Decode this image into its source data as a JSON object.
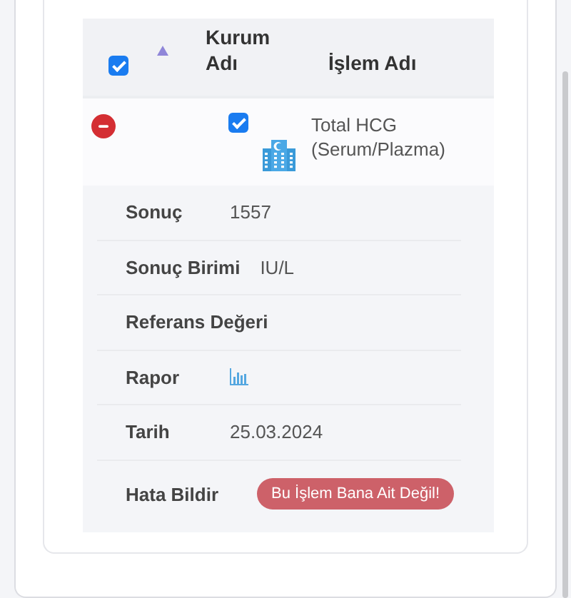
{
  "table": {
    "select_all": {
      "checked": true
    },
    "sort": {
      "ascending": true
    },
    "columns": [
      "Kurum Adı",
      "İşlem Adı"
    ],
    "rows": [
      {
        "checked": true,
        "expanded": true,
        "procedure": "Total HCG (Serum/Plazma)",
        "details": [
          {
            "kind": "text",
            "label": "Sonuç",
            "value": "1557"
          },
          {
            "kind": "text",
            "label": "Sonuç Birimi",
            "value": "IU/L"
          },
          {
            "kind": "text",
            "label": "Referans Değeri"
          },
          {
            "kind": "chart-link",
            "label": "Rapor"
          },
          {
            "kind": "text",
            "label": "Tarih",
            "value": "25.03.2024"
          },
          {
            "kind": "button",
            "label": "Hata Bildir",
            "button": "Bu İşlem Bana Ait Değil!"
          }
        ]
      }
    ]
  }
}
